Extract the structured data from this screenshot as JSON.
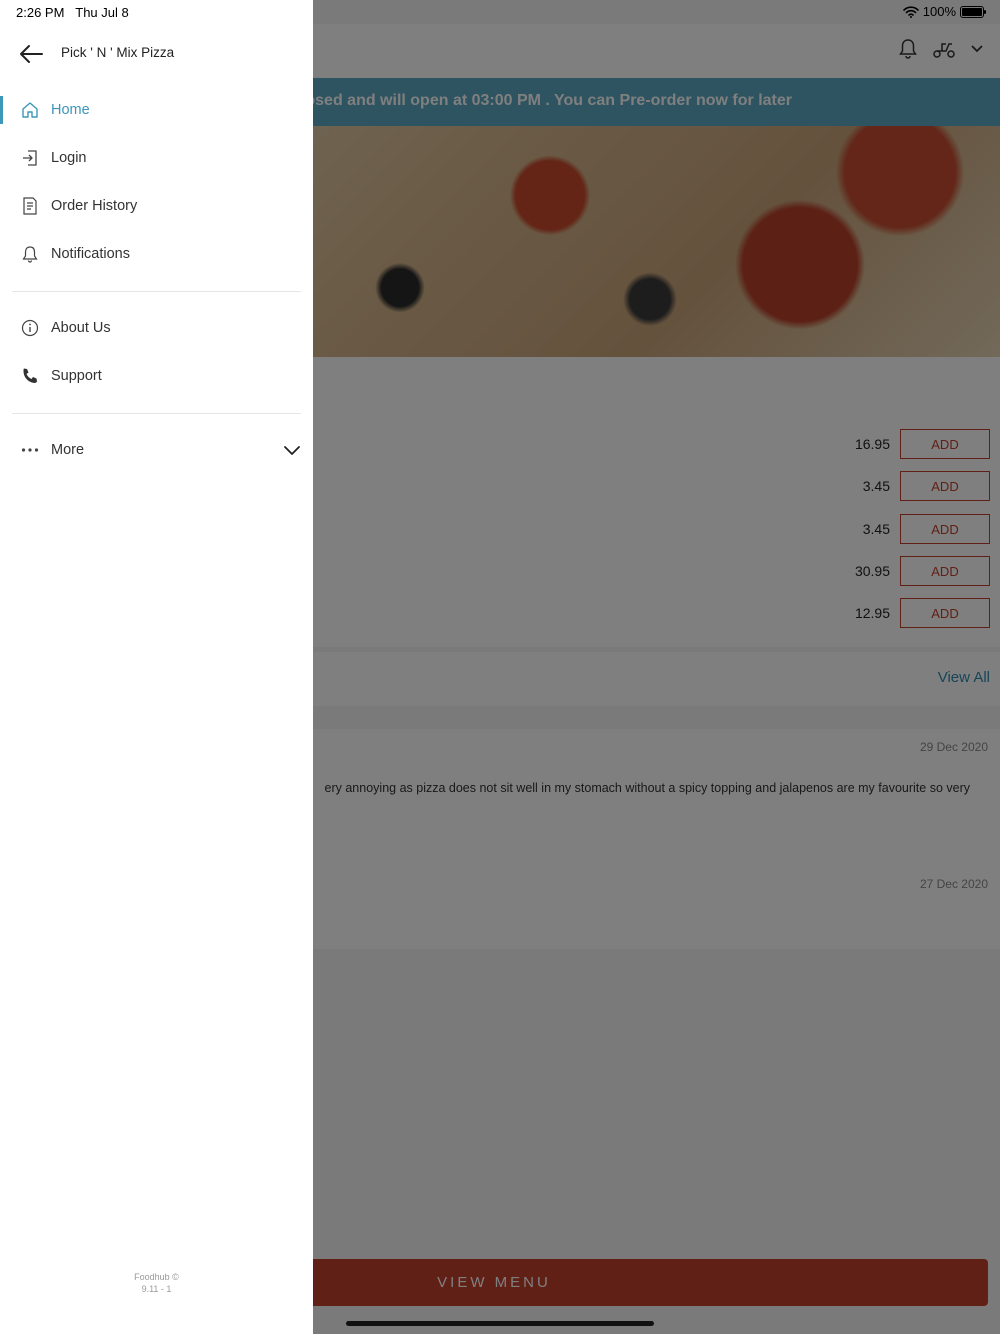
{
  "status_bar": {
    "time": "2:26 PM",
    "date": "Thu Jul 8",
    "battery": "100%"
  },
  "drawer": {
    "title": "Pick ' N ' Mix Pizza",
    "items_primary": [
      {
        "label": "Home",
        "icon": "home-icon",
        "active": true
      },
      {
        "label": "Login",
        "icon": "login-icon"
      },
      {
        "label": "Order History",
        "icon": "order-history-icon"
      },
      {
        "label": "Notifications",
        "icon": "bell-icon"
      }
    ],
    "items_secondary": [
      {
        "label": "About Us",
        "icon": "info-icon"
      },
      {
        "label": "Support",
        "icon": "phone-icon"
      }
    ],
    "more_label": "More",
    "footer_line1": "Foodhub ©",
    "footer_line2": "9.11 - 1"
  },
  "app": {
    "notice": "osed and will open at 03:00 PM . You can Pre-order now for later",
    "items": [
      {
        "price": "16.95",
        "button": "ADD"
      },
      {
        "price": "3.45",
        "button": "ADD"
      },
      {
        "price": "3.45",
        "button": "ADD"
      },
      {
        "price": "30.95",
        "button": "ADD"
      },
      {
        "price": "12.95",
        "button": "ADD"
      }
    ],
    "view_all": "View All",
    "reviews": [
      {
        "date": "29 Dec 2020",
        "text": "ery annoying as pizza does not sit well in my stomach without a spicy topping and jalapenos are my favourite so very"
      },
      {
        "date": "27 Dec 2020",
        "text": ""
      }
    ],
    "view_menu": "VIEW MENU"
  },
  "colors": {
    "accent": "#3d97b9",
    "brand": "#c0412b",
    "notice_bg": "#5aa9c0"
  }
}
